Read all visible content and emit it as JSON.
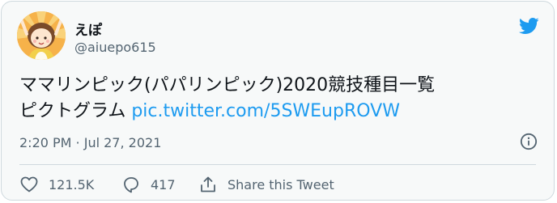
{
  "user": {
    "display_name": "えぽ",
    "handle": "@aiuepo615"
  },
  "tweet": {
    "text_line1": "ママリンピック(パパリンピック)2020競技種目一覧",
    "text_line2": "ピクトグラム",
    "link": "pic.twitter.com/5SWEupROVW"
  },
  "meta": {
    "timestamp": "2:20 PM · Jul 27, 2021"
  },
  "actions": {
    "likes": "121.5K",
    "replies": "417",
    "share_label": "Share this Tweet"
  },
  "colors": {
    "brand": "#1d9bf0",
    "text": "#0f1419",
    "muted": "#536471",
    "card_bg": "#f7f9f9",
    "border": "#cfd9de"
  },
  "icons": {
    "logo": "twitter-bird-icon",
    "info": "info-icon",
    "like": "heart-icon",
    "reply": "reply-bubble-icon",
    "share": "share-icon"
  }
}
